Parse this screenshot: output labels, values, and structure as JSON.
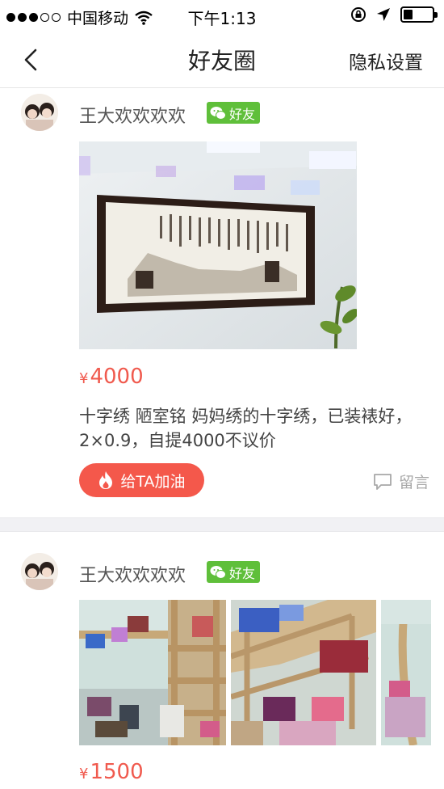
{
  "status_bar": {
    "carrier": "中国移动",
    "time": "下午1:13",
    "battery_level": 0.3
  },
  "nav": {
    "back_icon": "chevron-left-icon",
    "title": "好友圈",
    "right_label": "隐私设置"
  },
  "posts": [
    {
      "user_name": "王大欢欢欢欢",
      "badge_label": "好友",
      "price_symbol": "¥",
      "price": "4000",
      "description": "十字绣  陋室铭 妈妈绣的十字绣，已装裱好，2×0.9，自提4000不议价",
      "cheer_label": "给TA加油",
      "comment_label": "留言"
    },
    {
      "user_name": "王大欢欢欢欢",
      "badge_label": "好友",
      "price_symbol": "¥",
      "price": "1500"
    }
  ],
  "colors": {
    "accent": "#f4584b",
    "price": "#f05a4e",
    "friend_badge": "#5fbf3a"
  }
}
